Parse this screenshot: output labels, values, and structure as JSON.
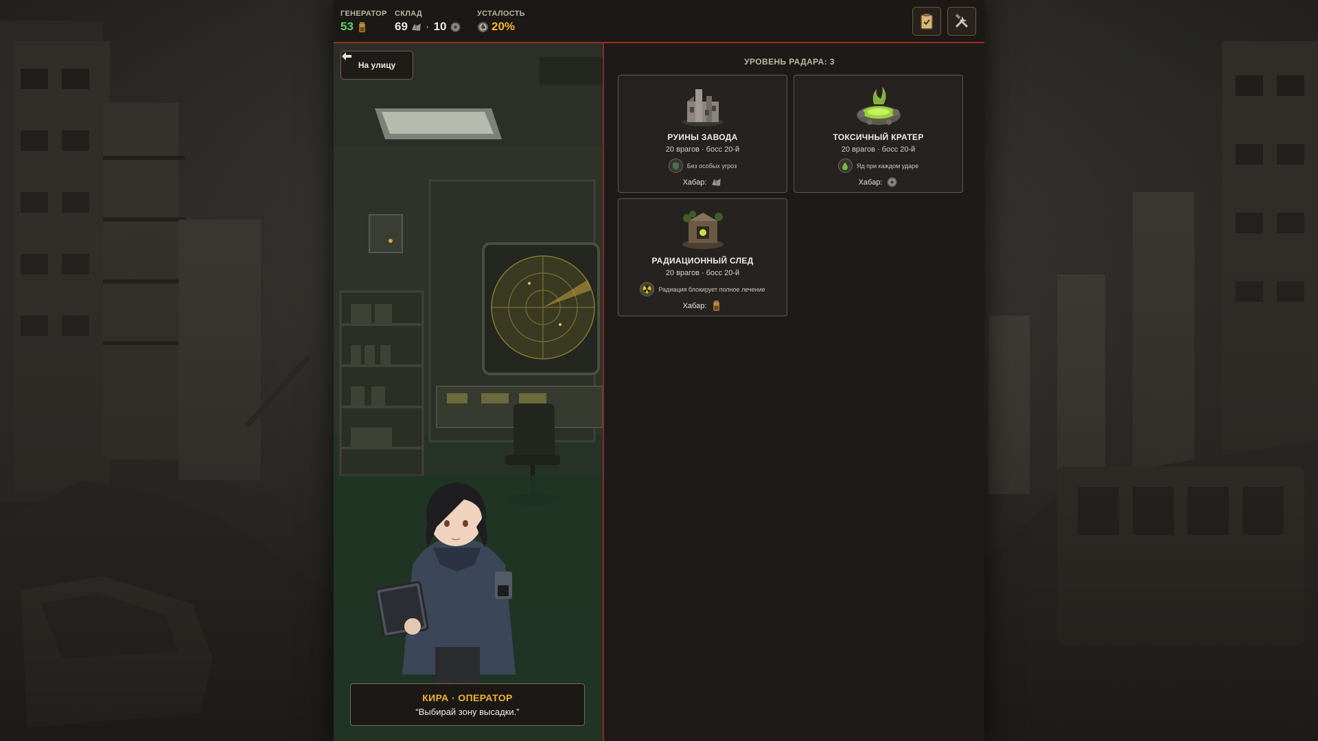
{
  "hud": {
    "generator": {
      "label": "ГЕНЕРАТОР",
      "value": "53",
      "icon": "battery-icon"
    },
    "storage": {
      "label": "СКЛАД",
      "scrap": "69",
      "scrap_icon": "scrap-icon",
      "separator": "·",
      "gears": "10",
      "gears_icon": "gear-icon"
    },
    "fatigue": {
      "label": "УСТАЛОСТЬ",
      "value": "20%",
      "icon": "fatigue-icon"
    },
    "buttons": [
      {
        "icon": "clipboard-icon"
      },
      {
        "icon": "tools-icon"
      }
    ]
  },
  "scene": {
    "back_label": "На улицу",
    "speaker": "КИРА · ОПЕРАТОР",
    "line": "“Выбирай зону высадки.”"
  },
  "radar": {
    "title": "УРОВЕНЬ РАДАРА: 3",
    "zones": [
      {
        "name": "РУИНЫ ЗАВОДА",
        "meta": "20 врагов · босс 20-й",
        "threat": "Без особых угроз",
        "threat_icon": "shield-icon",
        "loot_label": "Хабар:",
        "loot_icon": "scrap-icon"
      },
      {
        "name": "ТОКСИЧНЫЙ КРАТЕР",
        "meta": "20 врагов · босс 20-й",
        "threat": "Яд при каждом ударе",
        "threat_icon": "poison-drop-icon",
        "loot_label": "Хабар:",
        "loot_icon": "gear-icon"
      },
      {
        "name": "РАДИАЦИОННЫЙ СЛЕД",
        "meta": "20 врагов · босс 20-й",
        "threat": "Радиация блокирует полное лечение",
        "threat_icon": "radiation-icon",
        "loot_label": "Хабар:",
        "loot_icon": "battery-icon"
      }
    ]
  },
  "colors": {
    "accent_red": "#a52a22",
    "green": "#5fd66a",
    "yellow": "#f5b82e"
  }
}
